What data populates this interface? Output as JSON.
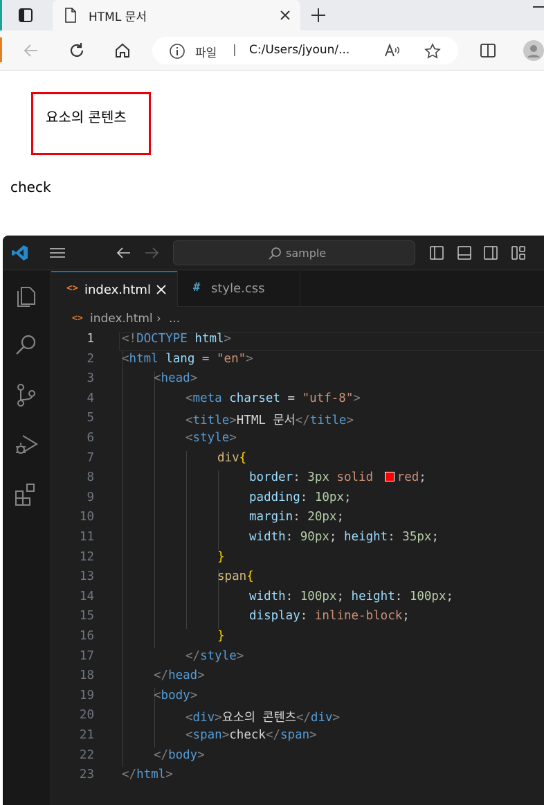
{
  "browser": {
    "tab_title": "HTML 문서",
    "address": {
      "scheme_label": "파일",
      "separator": "|",
      "url": "C:/Users/jyoun/..."
    }
  },
  "page": {
    "div_text": "요소의 콘텐츠",
    "span_text": "check",
    "div_border_color": "#e8000b"
  },
  "vscode": {
    "command_center": "sample",
    "tabs": [
      {
        "label": "index.html",
        "active": true,
        "icon": "html-file-icon"
      },
      {
        "label": "style.css",
        "active": false,
        "icon": "css-file-icon"
      }
    ],
    "breadcrumb": {
      "file": "index.html",
      "more": "..."
    },
    "active_line": 1,
    "lines": [
      {
        "n": "1"
      },
      {
        "n": "2"
      },
      {
        "n": "3"
      },
      {
        "n": "4"
      },
      {
        "n": "5"
      },
      {
        "n": "6"
      },
      {
        "n": "7"
      },
      {
        "n": "8"
      },
      {
        "n": "9"
      },
      {
        "n": "10"
      },
      {
        "n": "11"
      },
      {
        "n": "12"
      },
      {
        "n": "13"
      },
      {
        "n": "14"
      },
      {
        "n": "15"
      },
      {
        "n": "16"
      },
      {
        "n": "17"
      },
      {
        "n": "18"
      },
      {
        "n": "19"
      },
      {
        "n": "20"
      },
      {
        "n": "21"
      },
      {
        "n": "22"
      },
      {
        "n": "23"
      }
    ],
    "code": {
      "l1": {
        "open": "<!",
        "kw": "DOCTYPE",
        "sp": " ",
        "attr": "html",
        "close": ">"
      },
      "l2": {
        "open": "<",
        "tag": "html",
        "attr": " lang",
        "eq": " = ",
        "str": "\"en\"",
        "close": ">"
      },
      "l3": {
        "open": "<",
        "tag": "head",
        "close": ">"
      },
      "l4": {
        "open": "<",
        "tag": "meta",
        "attr": " charset",
        "eq": " = ",
        "str": "\"utf-8\"",
        "close": ">"
      },
      "l5": {
        "open": "<",
        "tag": "title",
        "close": ">",
        "text": "HTML 문서",
        "open2": "</",
        "tag2": "title",
        "close2": ">"
      },
      "l6": {
        "open": "<",
        "tag": "style",
        "close": ">"
      },
      "l7": {
        "sel": "div",
        "brace": "{"
      },
      "l8": {
        "prop": "border",
        "colon": ": ",
        "num": "3px",
        "val1": " solid ",
        "val2": "red",
        "semi": ";"
      },
      "l9": {
        "prop": "padding",
        "colon": ": ",
        "num": "10px",
        "semi": ";"
      },
      "l10": {
        "prop": "margin",
        "colon": ": ",
        "num": "20px",
        "semi": ";"
      },
      "l11": {
        "prop": "width",
        "colon": ": ",
        "num": "90px",
        "semi": "; ",
        "prop2": "height",
        "colon2": ": ",
        "num2": "35px",
        "semi2": ";"
      },
      "l12": {
        "brace": "}"
      },
      "l13": {
        "sel": "span",
        "brace": "{"
      },
      "l14": {
        "prop": "width",
        "colon": ": ",
        "num": "100px",
        "semi": "; ",
        "prop2": "height",
        "colon2": ": ",
        "num2": "100px",
        "semi2": ";"
      },
      "l15": {
        "prop": "display",
        "colon": ": ",
        "val": "inline-block",
        "semi": ";"
      },
      "l16": {
        "brace": "}"
      },
      "l17": {
        "open": "</",
        "tag": "style",
        "close": ">"
      },
      "l18": {
        "open": "</",
        "tag": "head",
        "close": ">"
      },
      "l19": {
        "open": "<",
        "tag": "body",
        "close": ">"
      },
      "l20": {
        "open": "<",
        "tag": "div",
        "close": ">",
        "text": "요소의 콘텐츠",
        "open2": "</",
        "tag2": "div",
        "close2": ">"
      },
      "l21": {
        "open": "<",
        "tag": "span",
        "close": ">",
        "text": "check",
        "open2": "</",
        "tag2": "span",
        "close2": ">"
      },
      "l22": {
        "open": "</",
        "tag": "body",
        "close": ">"
      },
      "l23": {
        "open": "</",
        "tag": "html",
        "close": ">"
      }
    }
  }
}
